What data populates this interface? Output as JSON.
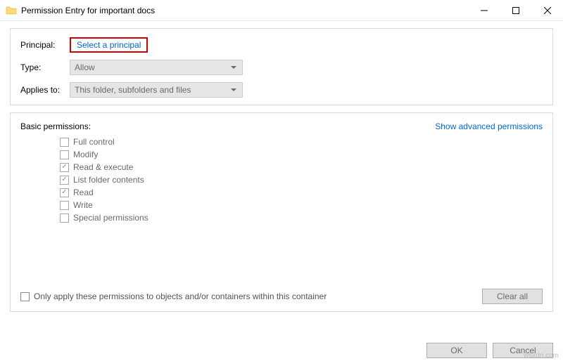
{
  "window": {
    "title": "Permission Entry for important docs"
  },
  "top": {
    "principal_label": "Principal:",
    "select_principal": "Select a principal",
    "type_label": "Type:",
    "type_value": "Allow",
    "applies_label": "Applies to:",
    "applies_value": "This folder, subfolders and files"
  },
  "perm": {
    "heading": "Basic permissions:",
    "advanced_link": "Show advanced permissions",
    "items": [
      {
        "label": "Full control",
        "checked": false
      },
      {
        "label": "Modify",
        "checked": false
      },
      {
        "label": "Read & execute",
        "checked": true
      },
      {
        "label": "List folder contents",
        "checked": true
      },
      {
        "label": "Read",
        "checked": true
      },
      {
        "label": "Write",
        "checked": false
      },
      {
        "label": "Special permissions",
        "checked": false
      }
    ],
    "only_apply": "Only apply these permissions to objects and/or containers within this container",
    "clear_all": "Clear all"
  },
  "footer": {
    "ok": "OK",
    "cancel": "Cancel"
  },
  "watermark": "wsxdn.com"
}
